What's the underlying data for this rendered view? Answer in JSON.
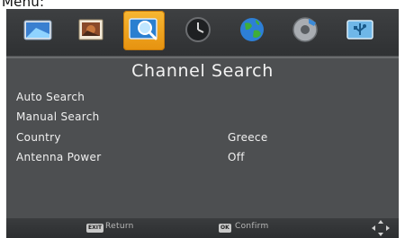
{
  "page_label": "Menu:",
  "tabs": [
    {
      "icon": "picture-icon",
      "active": false
    },
    {
      "icon": "photo-icon",
      "active": false
    },
    {
      "icon": "channel-search-icon",
      "active": true
    },
    {
      "icon": "clock-icon",
      "active": false
    },
    {
      "icon": "globe-icon",
      "active": false
    },
    {
      "icon": "settings-disc-icon",
      "active": false
    },
    {
      "icon": "usb-icon",
      "active": false
    }
  ],
  "title": "Channel Search",
  "menu": {
    "items": [
      {
        "label": "Auto Search",
        "value": ""
      },
      {
        "label": "Manual Search",
        "value": ""
      },
      {
        "label": "Country",
        "value": "Greece"
      },
      {
        "label": "Antenna Power",
        "value": "Off"
      }
    ]
  },
  "footer": {
    "return_key": "EXIT",
    "return_label": "Return",
    "confirm_key": "OK",
    "confirm_label": "Confirm"
  },
  "colors": {
    "active_tab": "#f0a020",
    "panel_bg": "#4d4f51",
    "text": "#f0f0f0"
  }
}
